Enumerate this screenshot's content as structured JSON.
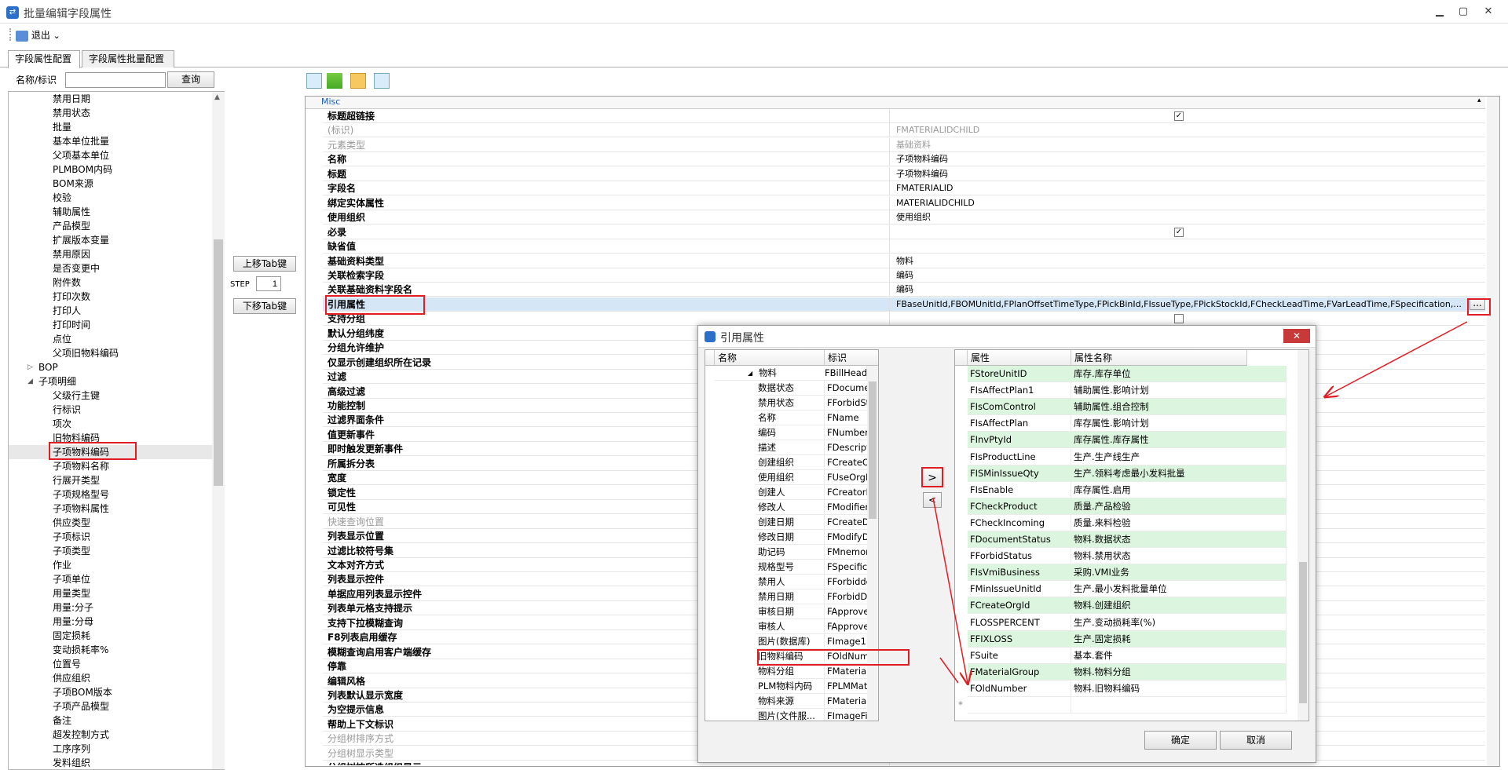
{
  "window": {
    "title": "批量编辑字段属性",
    "minimize": "▁",
    "maximize": "▢",
    "close": "✕"
  },
  "toolbar": {
    "exit_label": "退出",
    "dropdown": "⌄"
  },
  "tabs": [
    {
      "label": "字段属性配置"
    },
    {
      "label": "字段属性批量配置"
    }
  ],
  "search": {
    "label": "名称/标识",
    "value": "",
    "button": "查询"
  },
  "tree": {
    "items": [
      "禁用日期",
      "禁用状态",
      "批量",
      "基本单位批量",
      "父项基本单位",
      "PLMBOM内码",
      "BOM来源",
      "校验",
      "辅助属性",
      "产品模型",
      "扩展版本变量",
      "禁用原因",
      "是否变更中",
      "附件数",
      "打印次数",
      "打印人",
      "打印时间",
      "点位",
      "父项旧物料编码"
    ],
    "bop": "BOP",
    "detail": "子项明细",
    "detail_items": [
      "父级行主键",
      "行标识",
      "项次",
      "旧物料编码",
      "子项物料编码",
      "子项物料名称",
      "行展开类型",
      "子项规格型号",
      "子项物料属性",
      "供应类型",
      "子项标识",
      "子项类型",
      "作业",
      "子项单位",
      "用量类型",
      "用量:分子",
      "用量:分母",
      "固定损耗",
      "变动损耗率%",
      "位置号",
      "供应组织",
      "子项BOM版本",
      "子项产品模型",
      "备注",
      "超发控制方式",
      "工序序列",
      "发料组织"
    ],
    "selected": "子项物料编码"
  },
  "middle": {
    "up_label": "上移Tab键",
    "step_label": "STEP",
    "step_value": "1",
    "down_label": "下移Tab键"
  },
  "prop_toolbar_icons": [
    "sort-category-icon",
    "sort-alpha-icon",
    "property-page-icon",
    "events-icon"
  ],
  "prop_section": "Misc",
  "properties": [
    {
      "name": "标题超链接",
      "value": "",
      "check": true
    },
    {
      "name": "(标识)",
      "value": "FMATERIALIDCHILD",
      "gray": true
    },
    {
      "name": "元素类型",
      "value": "基础资料",
      "gray": true
    },
    {
      "name": "名称",
      "value": "子项物料编码"
    },
    {
      "name": "标题",
      "value": "子项物料编码"
    },
    {
      "name": "字段名",
      "value": "FMATERIALID"
    },
    {
      "name": "绑定实体属性",
      "value": "MATERIALIDCHILD"
    },
    {
      "name": "使用组织",
      "value": "使用组织"
    },
    {
      "name": "必录",
      "value": "",
      "check": true
    },
    {
      "name": "缺省值",
      "value": ""
    },
    {
      "name": "基础资料类型",
      "value": "物料"
    },
    {
      "name": "关联检索字段",
      "value": "编码"
    },
    {
      "name": "关联基础资料字段名",
      "value": "编码"
    },
    {
      "name": "引用属性",
      "value": "FBaseUnitId,FBOMUnitId,FPlanOffsetTimeType,FPickBinId,FIssueType,FPickStockId,FCheckLeadTime,FVarLeadTime,FSpecification,...",
      "selected": true
    },
    {
      "name": "支持分组",
      "value": "",
      "check": false
    },
    {
      "name": "默认分组纬度",
      "value": ""
    },
    {
      "name": "分组允许维护",
      "value": ""
    },
    {
      "name": "仅显示创建组织所在记录",
      "value": ""
    },
    {
      "name": "过滤",
      "value": ""
    },
    {
      "name": "高级过滤",
      "value": ""
    },
    {
      "name": "功能控制",
      "value": ""
    },
    {
      "name": "过滤界面条件",
      "value": ""
    },
    {
      "name": "值更新事件",
      "value": ""
    },
    {
      "name": "即时触发更新事件",
      "value": ""
    },
    {
      "name": "所属拆分表",
      "value": ""
    },
    {
      "name": "宽度",
      "value": ""
    },
    {
      "name": "锁定性",
      "value": ""
    },
    {
      "name": "可见性",
      "value": ""
    },
    {
      "name": "快速查询位置",
      "value": "",
      "gray": true
    },
    {
      "name": "列表显示位置",
      "value": ""
    },
    {
      "name": "过滤比较符号集",
      "value": ""
    },
    {
      "name": "文本对齐方式",
      "value": ""
    },
    {
      "name": "列表显示控件",
      "value": ""
    },
    {
      "name": "单据应用列表显示控件",
      "value": ""
    },
    {
      "name": "列表单元格支持提示",
      "value": ""
    },
    {
      "name": "支持下拉模糊查询",
      "value": ""
    },
    {
      "name": "F8列表启用缓存",
      "value": ""
    },
    {
      "name": "模糊查询启用客户端缓存",
      "value": ""
    },
    {
      "name": "停靠",
      "value": ""
    },
    {
      "name": "编辑风格",
      "value": ""
    },
    {
      "name": "列表默认显示宽度",
      "value": ""
    },
    {
      "name": "为空提示信息",
      "value": ""
    },
    {
      "name": "帮助上下文标识",
      "value": ""
    },
    {
      "name": "分组树排序方式",
      "value": "",
      "gray": true
    },
    {
      "name": "分组树显示类型",
      "value": "",
      "gray": true
    },
    {
      "name": "分组树按所选组织显示",
      "value": ""
    }
  ],
  "ellipsis": "...",
  "dialog": {
    "title": "引用属性",
    "left_headers": [
      "名称",
      "标识"
    ],
    "left_parent": {
      "name": "物料",
      "id": "FBillHead"
    },
    "left_rows": [
      {
        "name": "数据状态",
        "id": "FDocumentSt..."
      },
      {
        "name": "禁用状态",
        "id": "FForbidStatus"
      },
      {
        "name": "名称",
        "id": "FName"
      },
      {
        "name": "编码",
        "id": "FNumber"
      },
      {
        "name": "描述",
        "id": "FDescription"
      },
      {
        "name": "创建组织",
        "id": "FCreateOrgId"
      },
      {
        "name": "使用组织",
        "id": "FUseOrgId"
      },
      {
        "name": "创建人",
        "id": "FCreatorId"
      },
      {
        "name": "修改人",
        "id": "FModifierId"
      },
      {
        "name": "创建日期",
        "id": "FCreateDate"
      },
      {
        "name": "修改日期",
        "id": "FModifyDate"
      },
      {
        "name": "助记码",
        "id": "FMnemonicCo..."
      },
      {
        "name": "规格型号",
        "id": "FSpecification"
      },
      {
        "name": "禁用人",
        "id": "FForbidderId"
      },
      {
        "name": "禁用日期",
        "id": "FForbidDate"
      },
      {
        "name": "审核日期",
        "id": "FApproveDate"
      },
      {
        "name": "审核人",
        "id": "FApproverId"
      },
      {
        "name": "图片(数据库)",
        "id": "FImage1"
      },
      {
        "name": "旧物料编码",
        "id": "FOldNumber"
      },
      {
        "name": "物料分组",
        "id": "FMaterialGroup"
      },
      {
        "name": "PLM物料内码",
        "id": "FPLMMaterialId"
      },
      {
        "name": "物料来源",
        "id": "FMaterialSRC"
      },
      {
        "name": "图片(文件服...",
        "id": "FImageFileSer..."
      }
    ],
    "add_button": ">",
    "remove_button": "<",
    "right_headers": [
      "属性",
      "属性名称"
    ],
    "right_rows": [
      {
        "attr": "FStoreUnitID",
        "name": "库存.库存单位",
        "g": true
      },
      {
        "attr": "FIsAffectPlan1",
        "name": "辅助属性.影响计划",
        "g": false
      },
      {
        "attr": "FIsComControl",
        "name": "辅助属性.组合控制",
        "g": true
      },
      {
        "attr": "FIsAffectPlan",
        "name": "库存属性.影响计划",
        "g": false
      },
      {
        "attr": "FInvPtyId",
        "name": "库存属性.库存属性",
        "g": true
      },
      {
        "attr": "FIsProductLine",
        "name": "生产.生产线生产",
        "g": false
      },
      {
        "attr": "FISMinIssueQty",
        "name": "生产.领料考虑最小发料批量",
        "g": true
      },
      {
        "attr": "FIsEnable",
        "name": "库存属性.启用",
        "g": false
      },
      {
        "attr": "FCheckProduct",
        "name": "质量.产品检验",
        "g": true
      },
      {
        "attr": "FCheckIncoming",
        "name": "质量.来料检验",
        "g": false
      },
      {
        "attr": "FDocumentStatus",
        "name": "物料.数据状态",
        "g": true
      },
      {
        "attr": "FForbidStatus",
        "name": "物料.禁用状态",
        "g": false
      },
      {
        "attr": "FIsVmiBusiness",
        "name": "采购.VMI业务",
        "g": true
      },
      {
        "attr": "FMinIssueUnitId",
        "name": "生产.最小发料批量单位",
        "g": false
      },
      {
        "attr": "FCreateOrgId",
        "name": "物料.创建组织",
        "g": true
      },
      {
        "attr": "FLOSSPERCENT",
        "name": "生产.变动损耗率(%)",
        "g": false
      },
      {
        "attr": "FFIXLOSS",
        "name": "生产.固定损耗",
        "g": true
      },
      {
        "attr": "FSuite",
        "name": "基本.套件",
        "g": false
      },
      {
        "attr": "FMaterialGroup",
        "name": "物料.物料分组",
        "g": true
      },
      {
        "attr": "FOldNumber",
        "name": "物料.旧物料编码",
        "g": false
      }
    ],
    "new_row_marker": "*",
    "ok_label": "确定",
    "cancel_label": "取消"
  },
  "annotation_color": "#e21c24"
}
